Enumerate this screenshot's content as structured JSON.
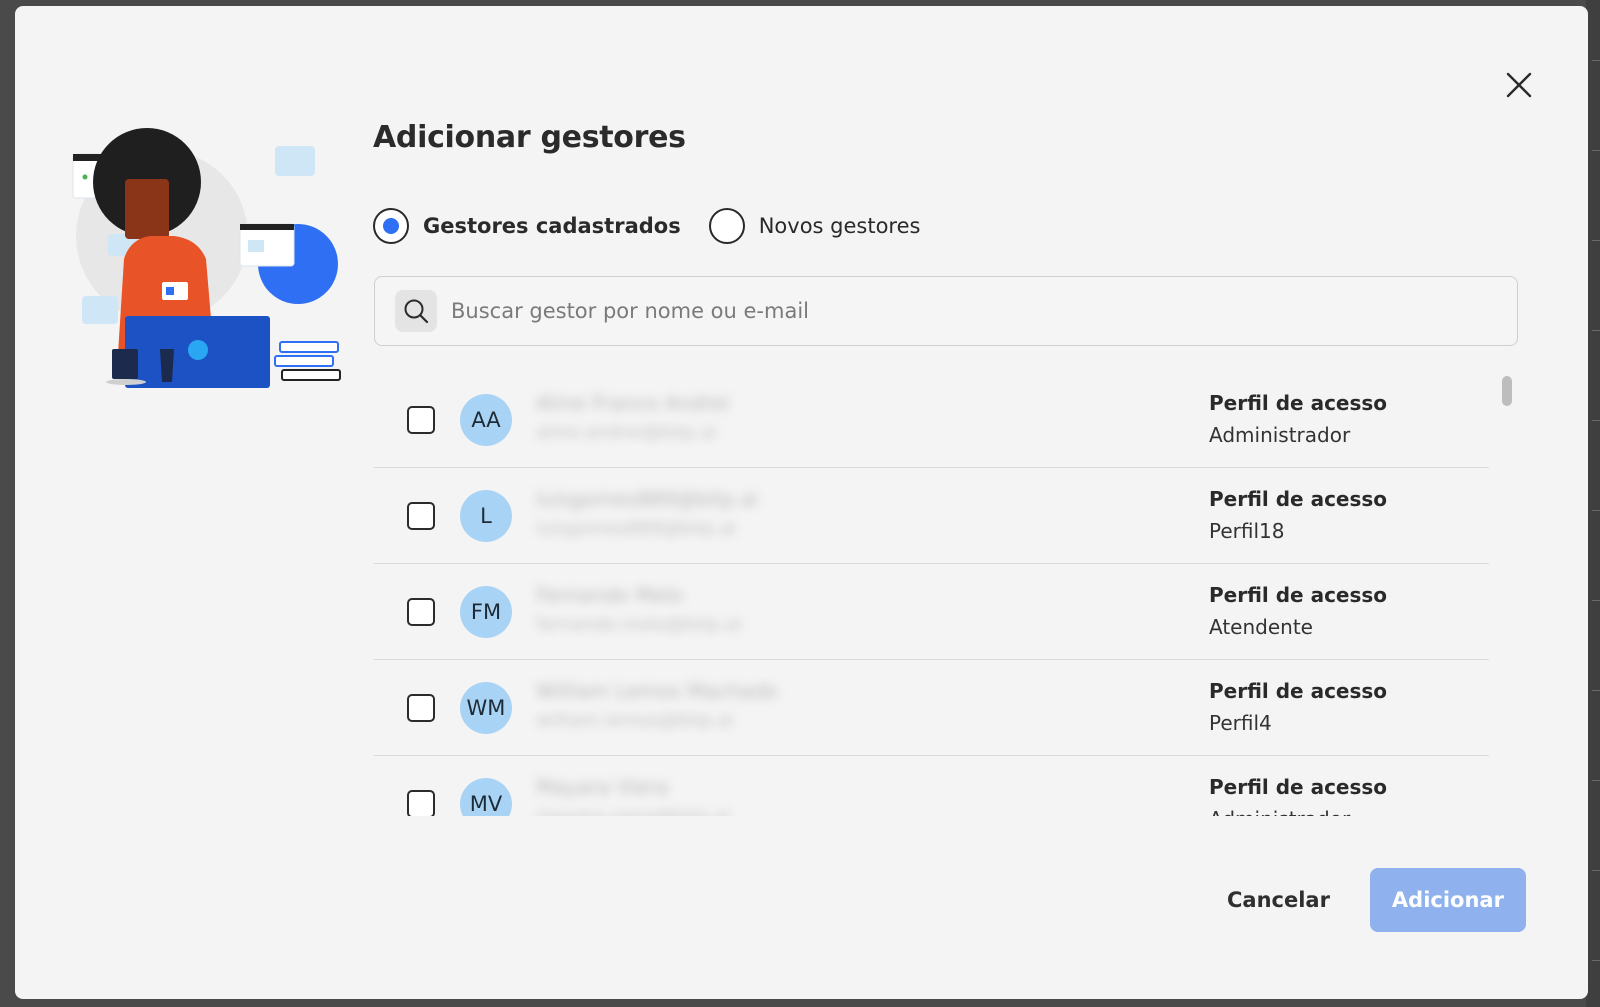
{
  "modal": {
    "title": "Adicionar gestores",
    "close_icon": "close-icon"
  },
  "radio": {
    "options": [
      {
        "label": "Gestores cadastrados",
        "selected": true
      },
      {
        "label": "Novos gestores",
        "selected": false
      }
    ]
  },
  "search": {
    "placeholder": "Buscar gestor por nome ou e-mail",
    "value": ""
  },
  "managers": {
    "profile_label": "Perfil de acesso",
    "rows": [
      {
        "initials": "AA",
        "name": "Aline Franco Andrei",
        "email": "aline.andrei@bitp.ai",
        "profile": "Administrador",
        "checked": false
      },
      {
        "initials": "L",
        "name": "luisgomes889@bitp.ai",
        "email": "luisgomes889@bitp.ai",
        "profile": "Perfil18",
        "checked": false
      },
      {
        "initials": "FM",
        "name": "Fernando Melo",
        "email": "fernando.melo@bitp.ai",
        "profile": "Atendente",
        "checked": false
      },
      {
        "initials": "WM",
        "name": "William Lemos Machado",
        "email": "william.lemos@bitp.ai",
        "profile": "Perfil4",
        "checked": false
      },
      {
        "initials": "MV",
        "name": "Mayara Viera",
        "email": "mayara.viera@bitp.ai",
        "profile": "Administrador",
        "checked": false
      }
    ]
  },
  "footer": {
    "cancel_label": "Cancelar",
    "add_label": "Adicionar"
  },
  "colors": {
    "accent": "#2f6ff3",
    "avatar_bg": "#a9d3f5",
    "primary_disabled": "#8fb2ee"
  }
}
